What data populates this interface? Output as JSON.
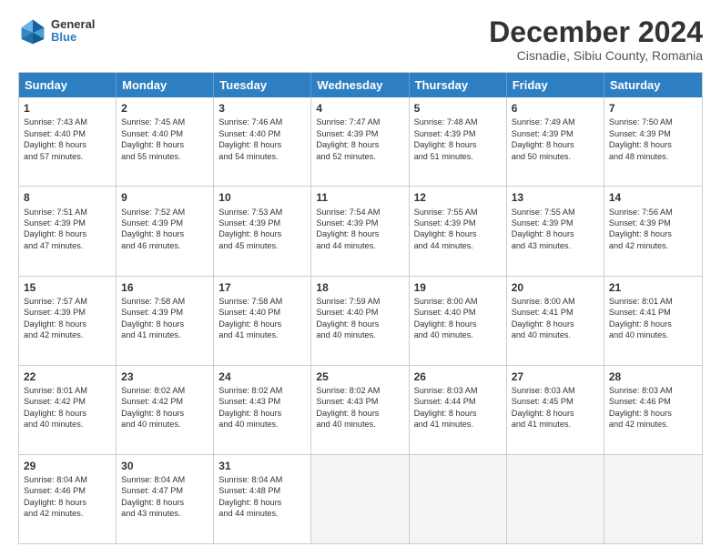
{
  "logo": {
    "general": "General",
    "blue": "Blue"
  },
  "title": "December 2024",
  "subtitle": "Cisnadie, Sibiu County, Romania",
  "days": [
    "Sunday",
    "Monday",
    "Tuesday",
    "Wednesday",
    "Thursday",
    "Friday",
    "Saturday"
  ],
  "rows": [
    [
      {
        "date": "1",
        "info": "Sunrise: 7:43 AM\nSunset: 4:40 PM\nDaylight: 8 hours\nand 57 minutes."
      },
      {
        "date": "2",
        "info": "Sunrise: 7:45 AM\nSunset: 4:40 PM\nDaylight: 8 hours\nand 55 minutes."
      },
      {
        "date": "3",
        "info": "Sunrise: 7:46 AM\nSunset: 4:40 PM\nDaylight: 8 hours\nand 54 minutes."
      },
      {
        "date": "4",
        "info": "Sunrise: 7:47 AM\nSunset: 4:39 PM\nDaylight: 8 hours\nand 52 minutes."
      },
      {
        "date": "5",
        "info": "Sunrise: 7:48 AM\nSunset: 4:39 PM\nDaylight: 8 hours\nand 51 minutes."
      },
      {
        "date": "6",
        "info": "Sunrise: 7:49 AM\nSunset: 4:39 PM\nDaylight: 8 hours\nand 50 minutes."
      },
      {
        "date": "7",
        "info": "Sunrise: 7:50 AM\nSunset: 4:39 PM\nDaylight: 8 hours\nand 48 minutes."
      }
    ],
    [
      {
        "date": "8",
        "info": "Sunrise: 7:51 AM\nSunset: 4:39 PM\nDaylight: 8 hours\nand 47 minutes."
      },
      {
        "date": "9",
        "info": "Sunrise: 7:52 AM\nSunset: 4:39 PM\nDaylight: 8 hours\nand 46 minutes."
      },
      {
        "date": "10",
        "info": "Sunrise: 7:53 AM\nSunset: 4:39 PM\nDaylight: 8 hours\nand 45 minutes."
      },
      {
        "date": "11",
        "info": "Sunrise: 7:54 AM\nSunset: 4:39 PM\nDaylight: 8 hours\nand 44 minutes."
      },
      {
        "date": "12",
        "info": "Sunrise: 7:55 AM\nSunset: 4:39 PM\nDaylight: 8 hours\nand 44 minutes."
      },
      {
        "date": "13",
        "info": "Sunrise: 7:55 AM\nSunset: 4:39 PM\nDaylight: 8 hours\nand 43 minutes."
      },
      {
        "date": "14",
        "info": "Sunrise: 7:56 AM\nSunset: 4:39 PM\nDaylight: 8 hours\nand 42 minutes."
      }
    ],
    [
      {
        "date": "15",
        "info": "Sunrise: 7:57 AM\nSunset: 4:39 PM\nDaylight: 8 hours\nand 42 minutes."
      },
      {
        "date": "16",
        "info": "Sunrise: 7:58 AM\nSunset: 4:39 PM\nDaylight: 8 hours\nand 41 minutes."
      },
      {
        "date": "17",
        "info": "Sunrise: 7:58 AM\nSunset: 4:40 PM\nDaylight: 8 hours\nand 41 minutes."
      },
      {
        "date": "18",
        "info": "Sunrise: 7:59 AM\nSunset: 4:40 PM\nDaylight: 8 hours\nand 40 minutes."
      },
      {
        "date": "19",
        "info": "Sunrise: 8:00 AM\nSunset: 4:40 PM\nDaylight: 8 hours\nand 40 minutes."
      },
      {
        "date": "20",
        "info": "Sunrise: 8:00 AM\nSunset: 4:41 PM\nDaylight: 8 hours\nand 40 minutes."
      },
      {
        "date": "21",
        "info": "Sunrise: 8:01 AM\nSunset: 4:41 PM\nDaylight: 8 hours\nand 40 minutes."
      }
    ],
    [
      {
        "date": "22",
        "info": "Sunrise: 8:01 AM\nSunset: 4:42 PM\nDaylight: 8 hours\nand 40 minutes."
      },
      {
        "date": "23",
        "info": "Sunrise: 8:02 AM\nSunset: 4:42 PM\nDaylight: 8 hours\nand 40 minutes."
      },
      {
        "date": "24",
        "info": "Sunrise: 8:02 AM\nSunset: 4:43 PM\nDaylight: 8 hours\nand 40 minutes."
      },
      {
        "date": "25",
        "info": "Sunrise: 8:02 AM\nSunset: 4:43 PM\nDaylight: 8 hours\nand 40 minutes."
      },
      {
        "date": "26",
        "info": "Sunrise: 8:03 AM\nSunset: 4:44 PM\nDaylight: 8 hours\nand 41 minutes."
      },
      {
        "date": "27",
        "info": "Sunrise: 8:03 AM\nSunset: 4:45 PM\nDaylight: 8 hours\nand 41 minutes."
      },
      {
        "date": "28",
        "info": "Sunrise: 8:03 AM\nSunset: 4:46 PM\nDaylight: 8 hours\nand 42 minutes."
      }
    ],
    [
      {
        "date": "29",
        "info": "Sunrise: 8:04 AM\nSunset: 4:46 PM\nDaylight: 8 hours\nand 42 minutes."
      },
      {
        "date": "30",
        "info": "Sunrise: 8:04 AM\nSunset: 4:47 PM\nDaylight: 8 hours\nand 43 minutes."
      },
      {
        "date": "31",
        "info": "Sunrise: 8:04 AM\nSunset: 4:48 PM\nDaylight: 8 hours\nand 44 minutes."
      },
      {
        "date": "",
        "info": ""
      },
      {
        "date": "",
        "info": ""
      },
      {
        "date": "",
        "info": ""
      },
      {
        "date": "",
        "info": ""
      }
    ]
  ]
}
